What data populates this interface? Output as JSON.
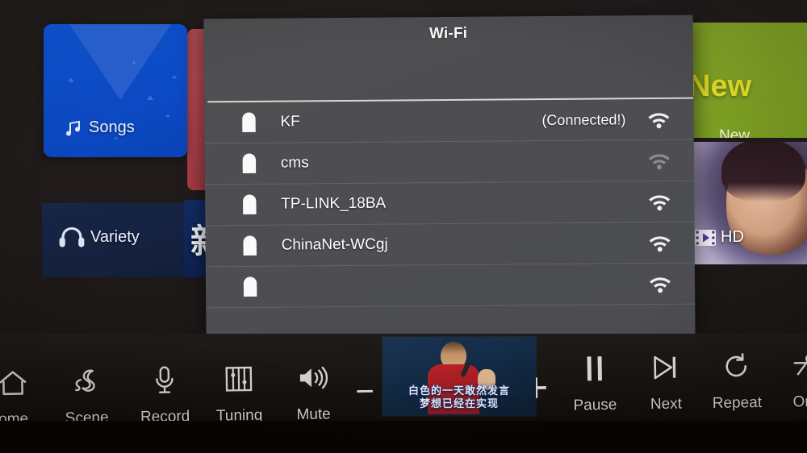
{
  "dialog": {
    "title": "Wi-Fi",
    "networks": [
      {
        "name": "KF",
        "status": "(Connected!)",
        "secured": true,
        "signal": "strong",
        "lock_icon": "lock-icon",
        "signal_icon": "wifi-signal-icon"
      },
      {
        "name": "cms",
        "status": "",
        "secured": true,
        "signal": "weak",
        "lock_icon": "lock-icon",
        "signal_icon": "wifi-signal-icon"
      },
      {
        "name": "TP-LINK_18BA",
        "status": "",
        "secured": true,
        "signal": "strong",
        "lock_icon": "lock-icon",
        "signal_icon": "wifi-signal-icon"
      },
      {
        "name": "ChinaNet-WCgj",
        "status": "",
        "secured": true,
        "signal": "strong",
        "lock_icon": "lock-icon",
        "signal_icon": "wifi-signal-icon"
      },
      {
        "name": "",
        "status": "",
        "secured": true,
        "signal": "strong",
        "lock_icon": "lock-icon",
        "signal_icon": "wifi-signal-icon"
      }
    ],
    "panel_color": "#55565a",
    "divider_color": "#dcdcdc"
  },
  "home": {
    "tiles": [
      {
        "id": "songs",
        "label": "Songs",
        "icon": "music-note-icon",
        "color": "#0c51cc"
      },
      {
        "id": "variety",
        "label": "Variety",
        "icon": "headphones-icon",
        "color": "#19294e"
      },
      {
        "id": "chinese",
        "label": "新",
        "icon": "",
        "color": "#123070"
      },
      {
        "id": "new",
        "label": "New",
        "heading": "New",
        "icon": "music-note-icon",
        "color": "#8aad28"
      },
      {
        "id": "hd",
        "label": "HD",
        "icon": "film-play-icon",
        "color": "#6b5f86"
      }
    ]
  },
  "toolbar": {
    "items": [
      {
        "label": "ome",
        "icon": "home-icon",
        "full": "Home"
      },
      {
        "label": "Scene",
        "icon": "scene-icon",
        "full": "Scene"
      },
      {
        "label": "Record",
        "icon": "mic-icon",
        "full": "Record"
      },
      {
        "label": "Tuning",
        "icon": "tuning-icon",
        "full": "Tuning"
      },
      {
        "label": "Mute",
        "icon": "speaker-icon",
        "full": "Mute"
      },
      {
        "label": "Pause",
        "icon": "pause-icon",
        "full": "Pause"
      },
      {
        "label": "Next",
        "icon": "next-icon",
        "full": "Next"
      },
      {
        "label": "Repeat",
        "icon": "repeat-icon",
        "full": "Repeat"
      },
      {
        "label": "Orig",
        "icon": "original-icon",
        "full": "Original"
      }
    ],
    "volume_down": "−",
    "volume_up": "+"
  },
  "preview": {
    "subtitle_line1": "白色的一天敢然发言",
    "subtitle_line2": "梦想已经在实现"
  }
}
